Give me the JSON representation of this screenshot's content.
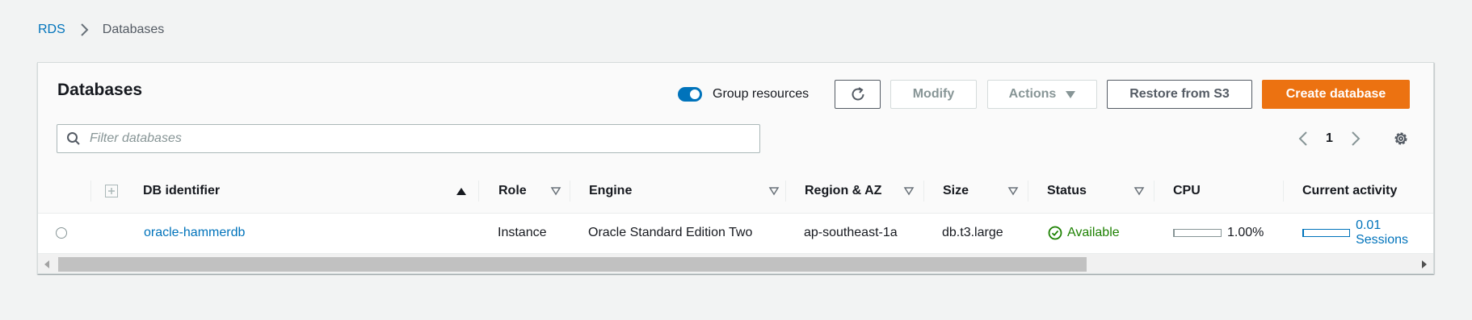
{
  "breadcrumb": {
    "root": "RDS",
    "current": "Databases"
  },
  "panel": {
    "title": "Databases",
    "group_resources_label": "Group resources",
    "group_resources_on": true
  },
  "toolbar": {
    "modify_label": "Modify",
    "actions_label": "Actions",
    "restore_label": "Restore from S3",
    "create_label": "Create database"
  },
  "filter": {
    "placeholder": "Filter databases",
    "value": ""
  },
  "pagination": {
    "current_page": "1"
  },
  "table": {
    "columns": {
      "db_identifier": "DB identifier",
      "role": "Role",
      "engine": "Engine",
      "region_az": "Region & AZ",
      "size": "Size",
      "status": "Status",
      "cpu": "CPU",
      "current_activity": "Current activity"
    },
    "rows": [
      {
        "db_identifier": "oracle-hammerdb",
        "role": "Instance",
        "engine": "Oracle Standard Edition Two",
        "region_az": "ap-southeast-1a",
        "size": "db.t3.large",
        "status": "Available",
        "cpu": "1.00%",
        "cpu_fraction": 0.01,
        "current_activity": "0.01 Sessions",
        "activity_fraction": 0.01
      }
    ]
  },
  "colors": {
    "link": "#0073bb",
    "primary": "#ec7211",
    "available": "#1d8102"
  }
}
